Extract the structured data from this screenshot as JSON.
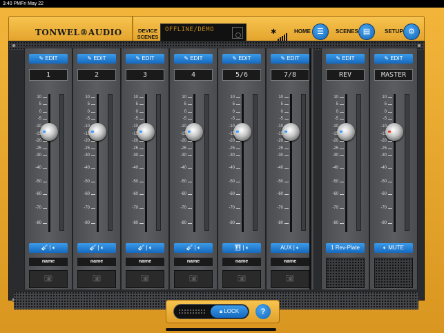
{
  "status": {
    "time": "3:40 PM",
    "date": "Fri May 22"
  },
  "header": {
    "brand": "TONWEL®AUDIO",
    "device_scenes_label": "DEVICE SCENES",
    "display_text": "OFFLINE/DEMO",
    "nav": [
      {
        "label": "HOME"
      },
      {
        "label": "SCENES"
      },
      {
        "label": "SETUP"
      }
    ]
  },
  "channels": [
    {
      "edit": "EDIT",
      "name": "1",
      "source": "guitar",
      "label": "name"
    },
    {
      "edit": "EDIT",
      "name": "2",
      "source": "guitar",
      "label": "name"
    },
    {
      "edit": "EDIT",
      "name": "3",
      "source": "guitar",
      "label": "name"
    },
    {
      "edit": "EDIT",
      "name": "4",
      "source": "guitar",
      "label": "name"
    },
    {
      "edit": "EDIT",
      "name": "5/6",
      "source": "keys",
      "label": "name"
    },
    {
      "edit": "EDIT",
      "name": "7/8",
      "source": "AUX",
      "label": "name"
    },
    {
      "edit": "EDIT",
      "name": "REV",
      "source": "1 Rev-Plate",
      "label": ""
    },
    {
      "edit": "EDIT",
      "name": "MASTER",
      "source": "MUTE",
      "label": ""
    }
  ],
  "scale": [
    "10",
    "5",
    "0",
    "-5",
    "-10",
    "-15",
    "-20",
    "-25",
    "-30",
    "-40",
    "-50",
    "-60",
    "-70",
    "-80"
  ],
  "lock": {
    "label": "LOCK"
  },
  "help": "?"
}
